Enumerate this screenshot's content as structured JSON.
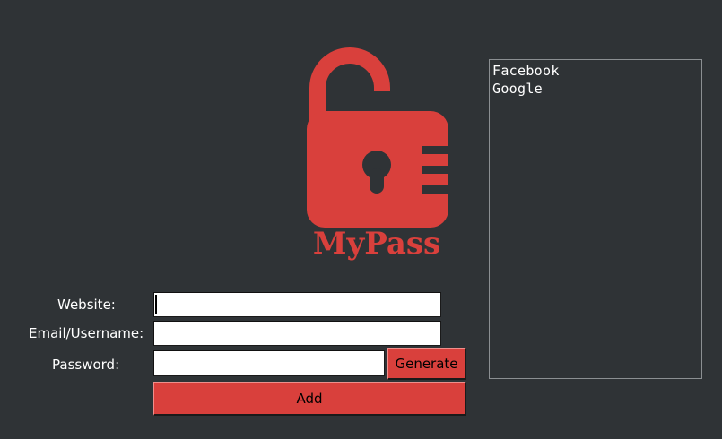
{
  "app": {
    "logo_text": "MyPass",
    "accent_color": "#d9403c",
    "background_color": "#2f3336"
  },
  "form": {
    "website_label": "Website:",
    "email_label": "Email/Username:",
    "password_label": "Password:",
    "website_value": "",
    "email_value": "",
    "password_value": "",
    "generate_label": "Generate",
    "add_label": "Add"
  },
  "saved_list": {
    "items": [
      "Facebook",
      "Google"
    ]
  },
  "icons": {
    "logo": "padlock-icon"
  }
}
